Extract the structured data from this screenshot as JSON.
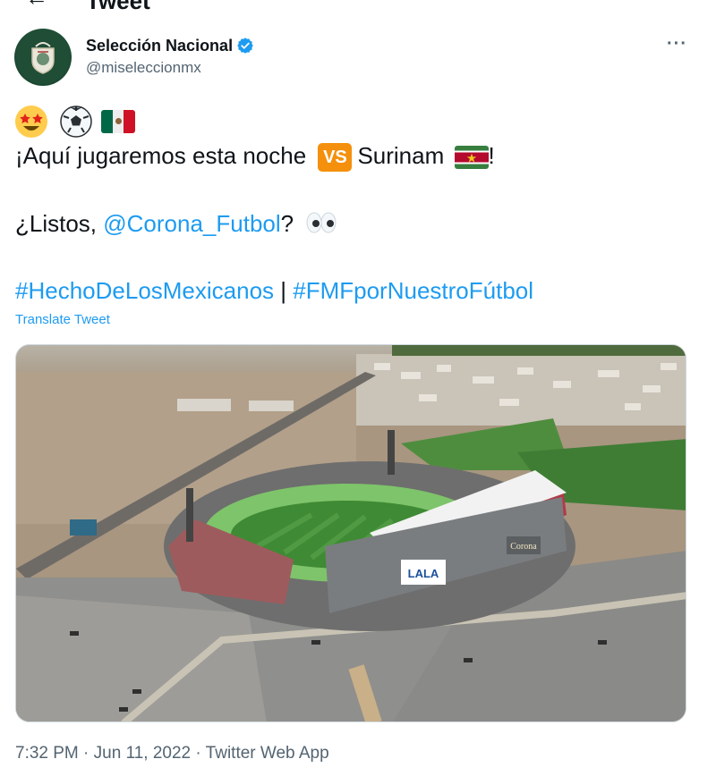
{
  "header": {
    "back_icon": "back-arrow-icon",
    "title": "Tweet"
  },
  "author": {
    "display_name": "Selección Nacional",
    "handle": "@miseleccionmx",
    "verified": true,
    "verified_color": "#1d9bf0"
  },
  "tweet": {
    "emoji_line": [
      "star-struck-emoji",
      "soccer-ball-emoji",
      "mexico-flag-emoji"
    ],
    "line2_text": "¡Aquí jugaremos esta noche",
    "vs_label": "VS",
    "line2_after_vs": "Surinam",
    "line2_end": "!",
    "line3_before": "¿Listos, ",
    "mention": "@Corona_Futbol",
    "line3_after": "?",
    "hashtag1": "#HechoDeLosMexicanos",
    "separator": " | ",
    "hashtag2": "#FMFporNuestroFútbol",
    "translate_label": "Translate Tweet"
  },
  "media": {
    "alt_icon": "stadium-photo",
    "stadium_sign_1": "LALA",
    "stadium_sign_2": "Corona"
  },
  "meta": {
    "time": "7:32 PM",
    "dot": " · ",
    "date": "Jun 11, 2022",
    "source": "Twitter Web App"
  },
  "colors": {
    "link": "#1d9bf0",
    "secondary": "#536471",
    "text": "#0f1419"
  }
}
